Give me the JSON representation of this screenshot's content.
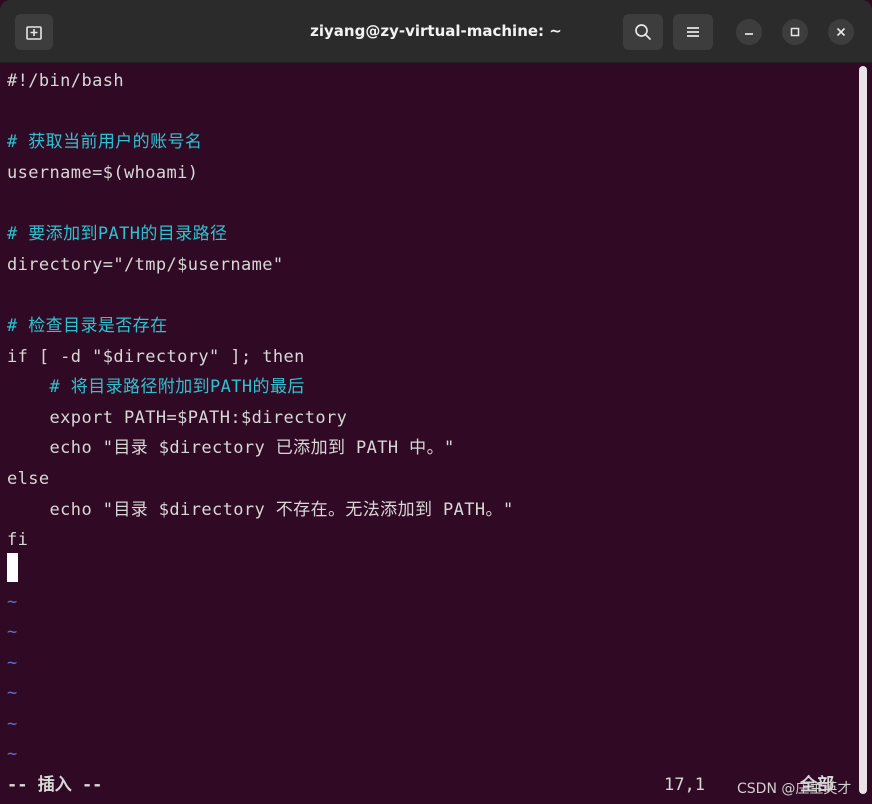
{
  "window": {
    "title": "ziyang@zy-virtual-machine: ~",
    "new_tab_icon": "new-tab-icon",
    "search_icon": "search-icon",
    "menu_icon": "hamburger-menu-icon",
    "minimize_glyph": "–",
    "maximize_glyph": "□",
    "close_glyph": "✕"
  },
  "editor": {
    "lines": [
      "#!/bin/bash",
      "",
      "# 获取当前用户的账号名",
      "username=$(whoami)",
      "",
      "# 要添加到PATH的目录路径",
      "directory=\"/tmp/$username\"",
      "",
      "# 检查目录是否存在",
      "if [ -d \"$directory\" ]; then",
      "    # 将目录路径附加到PATH的最后",
      "    export PATH=$PATH:$directory",
      "    echo \"目录 $directory 已添加到 PATH 中。\"",
      "else",
      "    echo \"目录 $directory 不存在。无法添加到 PATH。\"",
      "fi"
    ],
    "empty_marker": "~",
    "mode": "-- 插入 --",
    "position": "17,1",
    "scroll": "全部"
  },
  "watermark": "CSDN @庄主英才"
}
